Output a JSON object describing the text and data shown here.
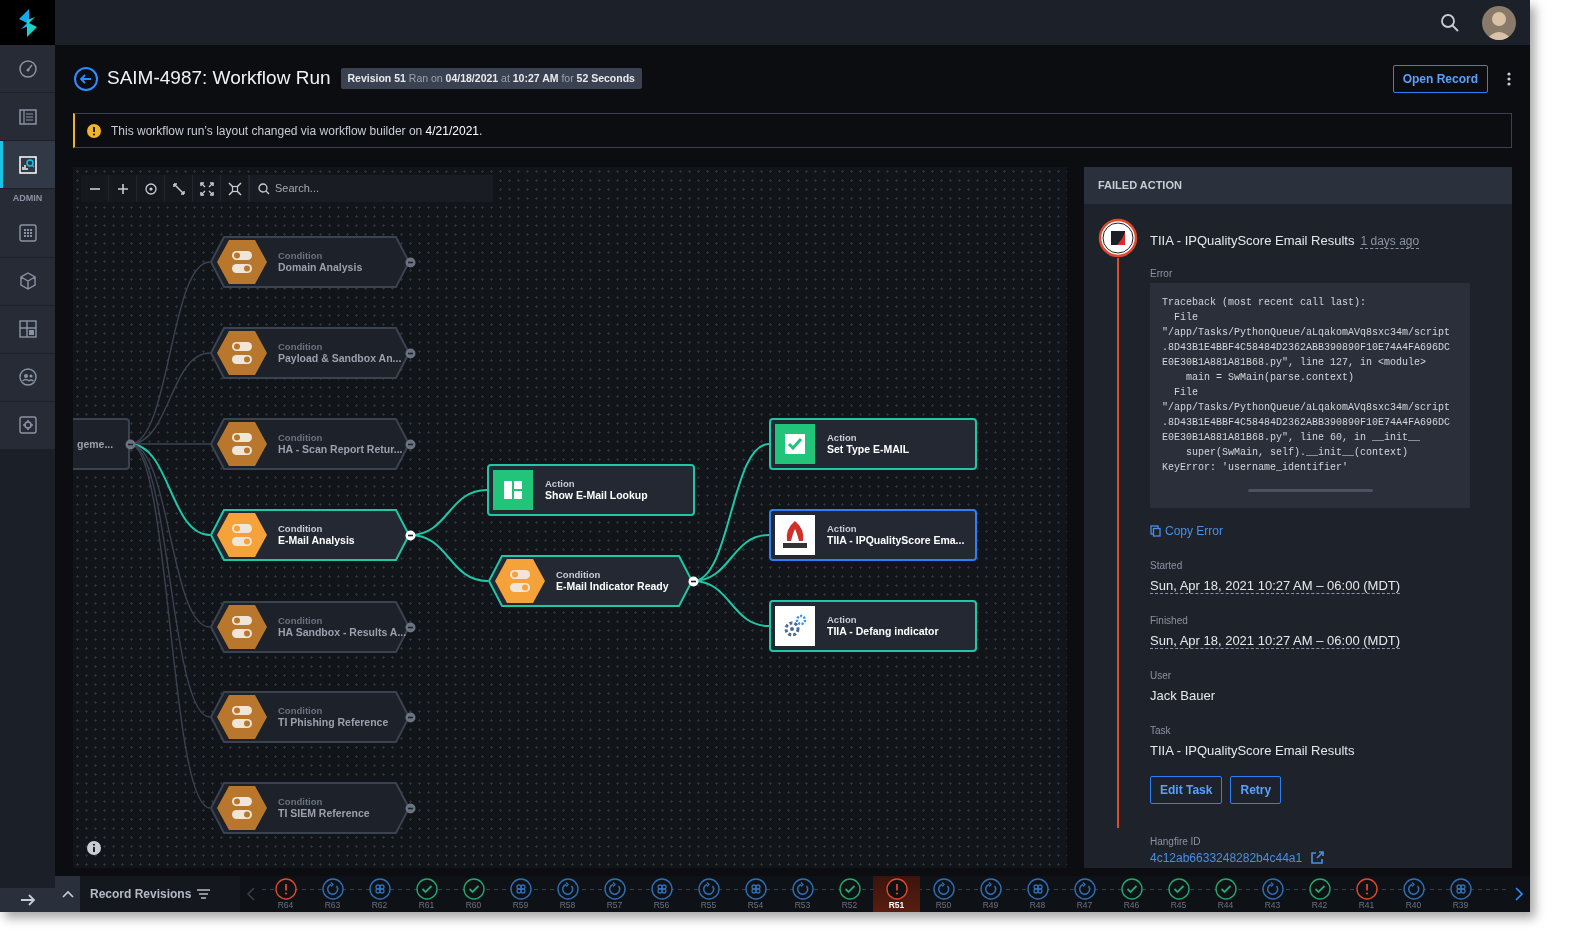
{
  "sidebar": {
    "section_label": "ADMIN",
    "items": [
      {
        "selected": false
      },
      {
        "selected": false
      },
      {
        "selected": true
      },
      {
        "selected": false
      },
      {
        "selected": false
      },
      {
        "selected": false
      },
      {
        "selected": false
      },
      {
        "selected": false
      }
    ]
  },
  "header": {
    "title": "SAIM-4987: Workflow Run",
    "revision_info": "**Revision 51** Ran on **04/18/2021** at **10:27 AM** for **52 Seconds**",
    "open_button": "Open Record"
  },
  "banner": {
    "text": "This workflow run’s layout changed via workflow builder on **4/21/2021**."
  },
  "canvas": {
    "search_placeholder": "Search...",
    "nodes": [
      {
        "kind": "plain",
        "title": "geme...",
        "active": false
      },
      {
        "kind": "condition",
        "type": "Condition",
        "title": "Domain Analysis",
        "active": false
      },
      {
        "kind": "condition",
        "type": "Condition",
        "title": "Payload & Sandbox An...",
        "active": false
      },
      {
        "kind": "condition",
        "type": "Condition",
        "title": "HA - Scan Report Retur...",
        "active": false
      },
      {
        "kind": "condition",
        "type": "Condition",
        "title": "E-Mail Analysis",
        "active": true
      },
      {
        "kind": "condition",
        "type": "Condition",
        "title": "HA Sandbox - Results A...",
        "active": false
      },
      {
        "kind": "condition",
        "type": "Condition",
        "title": "TI Phishing Reference",
        "active": false
      },
      {
        "kind": "condition",
        "type": "Condition",
        "title": "TI SIEM Reference",
        "active": false
      },
      {
        "kind": "action",
        "type": "Action",
        "title": "Show E-Mail Lookup",
        "active": true
      },
      {
        "kind": "condition",
        "type": "Condition",
        "title": "E-Mail Indicator Ready",
        "active": true
      },
      {
        "kind": "action",
        "type": "Action",
        "title": "Set Type E-MAIL",
        "active": true
      },
      {
        "kind": "action",
        "type": "Action",
        "title": "TIIA - IPQualityScore Ema...",
        "active": true,
        "failed": true
      },
      {
        "kind": "action",
        "type": "Action",
        "title": "TIIA - Defang indicator",
        "active": true
      }
    ]
  },
  "failed_action": {
    "header": "FAILED ACTION",
    "title": "TIIA - IPQualityScore Email Results",
    "time_ago": "1 days ago",
    "error_label": "Error",
    "traceback": [
      "Traceback (most recent call last):",
      "  File",
      "\"/app/Tasks/PythonQueue/aLqakomAVq8sxc34m/script",
      ".8D43B1E4BBF4C58484D2362ABB390890F10E74A4FA696DC",
      "E0E30B1A881A81B68.py\", line 127, in <module>",
      "    main = SwMain(parse.context)",
      "  File",
      "\"/app/Tasks/PythonQueue/aLqakomAVq8sxc34m/script",
      ".8D43B1E4BBF4C58484D2362ABB390890F10E74A4FA696DC",
      "E0E30B1A881A81B68.py\", line 60, in __init__",
      "    super(SwMain, self).__init__(context)",
      "KeyError: 'username_identifier'"
    ],
    "copy_label": "Copy Error",
    "fields": [
      {
        "label": "Started",
        "value": "Sun, Apr 18, 2021 10:27 AM – 06:00 (MDT)",
        "kind": "timestamp"
      },
      {
        "label": "Finished",
        "value": "Sun, Apr 18, 2021 10:27 AM – 06:00 (MDT)",
        "kind": "timestamp"
      },
      {
        "label": "User",
        "value": "Jack Bauer",
        "kind": "text"
      },
      {
        "label": "Task",
        "value": "TIIA - IPQualityScore Email Results",
        "kind": "text"
      }
    ],
    "buttons": [
      "Edit Task",
      "Retry"
    ],
    "hangfire": {
      "label": "Hangfire ID",
      "value": "4c12ab6633248282b4c44a1"
    }
  },
  "revisions": {
    "title": "Record Revisions",
    "items": [
      {
        "label": "R64",
        "kind": "failed",
        "selected": false
      },
      {
        "label": "R63",
        "kind": "pending",
        "selected": false
      },
      {
        "label": "R62",
        "kind": "queued",
        "selected": false
      },
      {
        "label": "R61",
        "kind": "success",
        "selected": false
      },
      {
        "label": "R60",
        "kind": "success",
        "selected": false
      },
      {
        "label": "R59",
        "kind": "queued",
        "selected": false
      },
      {
        "label": "R58",
        "kind": "pending",
        "selected": false
      },
      {
        "label": "R57",
        "kind": "pending",
        "selected": false
      },
      {
        "label": "R56",
        "kind": "queued",
        "selected": false
      },
      {
        "label": "R55",
        "kind": "pending",
        "selected": false
      },
      {
        "label": "R54",
        "kind": "queued",
        "selected": false
      },
      {
        "label": "R53",
        "kind": "pending",
        "selected": false
      },
      {
        "label": "R52",
        "kind": "success",
        "selected": false
      },
      {
        "label": "R51",
        "kind": "failed",
        "selected": true
      },
      {
        "label": "R50",
        "kind": "pending",
        "selected": false
      },
      {
        "label": "R49",
        "kind": "pending",
        "selected": false
      },
      {
        "label": "R48",
        "kind": "queued",
        "selected": false
      },
      {
        "label": "R47",
        "kind": "pending",
        "selected": false
      },
      {
        "label": "R46",
        "kind": "success",
        "selected": false
      },
      {
        "label": "R45",
        "kind": "success",
        "selected": false
      },
      {
        "label": "R44",
        "kind": "success",
        "selected": false
      },
      {
        "label": "R43",
        "kind": "pending",
        "selected": false
      },
      {
        "label": "R42",
        "kind": "success",
        "selected": false
      },
      {
        "label": "R41",
        "kind": "failed",
        "selected": false
      },
      {
        "label": "R40",
        "kind": "pending",
        "selected": false
      },
      {
        "label": "R39",
        "kind": "queued",
        "selected": false
      }
    ]
  }
}
